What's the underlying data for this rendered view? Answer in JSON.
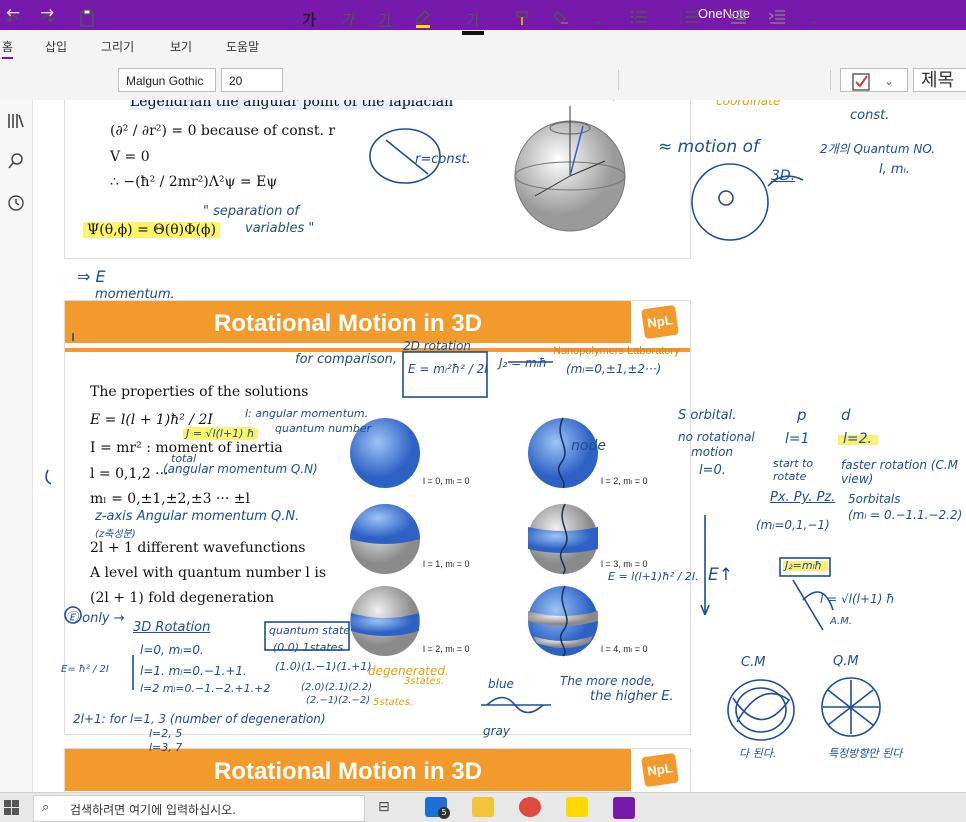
{
  "window": {
    "title": "OneNote",
    "colors": {
      "titlebar": "#7719aa",
      "accent_orange": "#f39a2c",
      "ink_blue": "#1d4f91",
      "ink_yellow": "#e2a400"
    }
  },
  "titlebar": {
    "back_icon": "←",
    "forward_icon": "→"
  },
  "menu": [
    "홈",
    "삽입",
    "그리기",
    "보기",
    "도움말"
  ],
  "toolbar": {
    "font_name": "Malgun Gothic",
    "font_size": "20",
    "bold": "가",
    "italic": "가",
    "underline": "가",
    "highlight": "가",
    "style_label": "제목"
  },
  "icons": [
    "undo-icon",
    "redo-icon",
    "clipboard-icon",
    "highlighter-icon",
    "format-painter-icon",
    "eraser-icon",
    "bullets-icon",
    "numbering-icon",
    "outdent-icon",
    "indent-icon",
    "todo-checkbox-icon",
    "library-icon",
    "search-icon",
    "recent-icon"
  ],
  "slide1": {
    "line1": "Legendrian the angular point of the laplacian",
    "line2": "(∂² / ∂r²) = 0   because of const.  r",
    "line3": "V = 0",
    "line4": "∴ −(ħ² / 2mr²)Λ²ψ = Eψ",
    "line5": "Ψ(θ,ϕ) = Θ(θ)Φ(ϕ)"
  },
  "slide2": {
    "title": "Rotational Motion in 3D",
    "logo": "NpL",
    "lab": "Nanopolymers Laboratory",
    "lines": [
      "The properties of the solutions",
      "E = l(l + 1)ħ² / 2I",
      "I = mr² : moment of inertia",
      "l = 0,1,2 ···",
      "mₗ = 0,±1,±2,±3 ··· ±l",
      "2l + 1   different wavefunctions",
      "A  level with quantum number l is",
      "(2l + 1) fold degeneration"
    ],
    "sphere_captions": [
      "l = 0, mₗ = 0",
      "l = 2, mₗ = 0",
      "l = 1, mₗ = 0",
      "l = 3, mₗ = 0",
      "l = 2, mₗ = 0",
      "l = 4, mₗ = 0"
    ]
  },
  "slide3": {
    "title": "Rotational Motion in 3D",
    "logo": "NpL"
  },
  "ink_notes": {
    "const1": "r=const.",
    "const2": "const.",
    "motion_of": "≈ motion of",
    "three_d": "3D.",
    "quantum_no_1": "2개의 Quantum NO.",
    "quantum_no_2": "l, mₗ.",
    "coordinate": "coordinate",
    "separation_1": "\" separation of",
    "separation_2": "variables \"",
    "arrow_e": "⇒ E",
    "momentum": "momentum.",
    "rotation_2d": "2D rotation",
    "for_comparison": "for comparison,",
    "e_formula": "E = mₗ²ħ² / 2I",
    "jz_formula": "J₂ = mₗħ",
    "ml_values": "(mₗ=0,±1,±2···)",
    "l_angular": "l: angular momentum.",
    "quantum_number": "quantum number",
    "j_formula": "J = √l(l+1) ħ",
    "total": "total",
    "angular_qn": "(angular momentum Q.N)",
    "z_axis": "z-axis Angular momentum Q.N.",
    "korean_z": "(z축성분)",
    "node": "node",
    "s_orbital": "S orbital.",
    "no_rotational": "no rotational",
    "motion": "motion",
    "l_zero": "l=0.",
    "p": "p",
    "d": "d",
    "l_one": "l=1",
    "l_two": "l=2.",
    "start_rotate": "start to rotate",
    "faster_rotation": "faster rotation (C.M view)",
    "p_orbitals": "Px. Py. Pz.",
    "ml_p": "(mₗ=0,1,−1)",
    "five_orbitals": "5orbitals",
    "ml_d": "(mₗ = 0.−1.1.−2.2)",
    "e_up": "E↑",
    "e_ratio": "E = l(l+1)ħ² / 2I.",
    "jz_box": "J₂=mₗħ",
    "l_sqrt": "l = √l(l+1) ħ",
    "am": "A.M.",
    "cm": "C.M",
    "qm": "Q.M",
    "korean_cm": "다 된다.",
    "korean_qm": "특정방향만 된다",
    "e_only": "Ⓔ only →",
    "rotation3d": "3D Rotation",
    "qstate": "quantum state",
    "l0": "l=0,  mₗ=0.",
    "l1": "l=1.  mₗ=0.−1.+1.",
    "l2": "l=2   mₗ=0.−1.−2.+1.+2",
    "s00": "(0.0)  1states",
    "s1": "(1.0)(1.−1)(1.+1)",
    "s2a": "(2.0)(2.1)(2.2)",
    "s2b": "(2.−1)(2.−2)",
    "degenerated": "degenerated.",
    "three_states": "3states.",
    "five_states": "5states.",
    "e_frac": "E= ħ² / 2I",
    "two_l_plus_one": "2l+1:  for l=1, 3 (number of degeneration)",
    "l2_5": "l=2, 5",
    "l3_7": "l=3, 7",
    "blue": "blue",
    "gray": "gray",
    "more_node_1": "The more node,",
    "more_node_2": "the higher E."
  },
  "taskbar": {
    "search_placeholder": "검색하려면 여기에 입력하십시오.",
    "mail_badge": "5"
  }
}
